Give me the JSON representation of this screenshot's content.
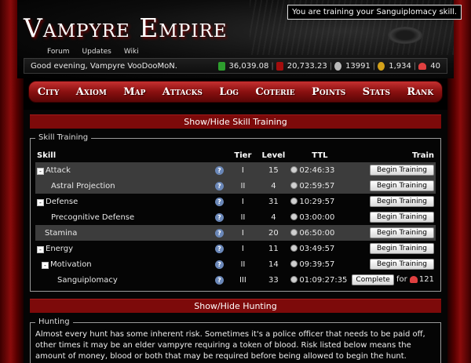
{
  "notice": "You are training your Sanguiplomacy skill.",
  "logo": "Vampyre Empire",
  "top_links": [
    "Forum",
    "Updates",
    "Wiki"
  ],
  "status": {
    "greeting": "Good evening, Vampyre VooDooMoN.",
    "money": "36,039.08",
    "blood": "20,733.23",
    "population": "13991",
    "coins": "1,934",
    "hearts": "40"
  },
  "menu": [
    "City",
    "Axiom",
    "Map",
    "Attacks",
    "Log",
    "Coterie",
    "Points",
    "Stats",
    "Rank"
  ],
  "skill_toggle": "Show/Hide Skill Training",
  "skill_legend": "Skill Training",
  "skill_headers": {
    "skill": "Skill",
    "tier": "Tier",
    "level": "Level",
    "ttl": "TTL",
    "train": "Train"
  },
  "skills": [
    {
      "box": "-",
      "name": "Attack",
      "tier": "I",
      "level": "15",
      "ttl": "02:46:33",
      "action": "Begin Training"
    },
    {
      "box": "",
      "name": "Astral Projection",
      "tier": "II",
      "level": "4",
      "ttl": "02:59:57",
      "action": "Begin Training"
    },
    {
      "box": "-",
      "name": "Defense",
      "tier": "I",
      "level": "31",
      "ttl": "10:29:57",
      "action": "Begin Training"
    },
    {
      "box": "",
      "name": "Precognitive Defense",
      "tier": "II",
      "level": "4",
      "ttl": "03:00:00",
      "action": "Begin Training"
    },
    {
      "box": "",
      "name": "Stamina",
      "tier": "I",
      "level": "20",
      "ttl": "06:50:00",
      "action": "Begin Training"
    },
    {
      "box": "-",
      "name": "Energy",
      "tier": "I",
      "level": "11",
      "ttl": "03:49:57",
      "action": "Begin Training"
    },
    {
      "box": "-",
      "name": "Motivation",
      "tier": "II",
      "level": "14",
      "ttl": "09:39:57",
      "action": "Begin Training"
    },
    {
      "box": "",
      "name": "Sanguiplomacy",
      "tier": "III",
      "level": "33",
      "ttl": "01:09:27:35",
      "action": "Complete",
      "for_label": "for",
      "cost": "121"
    }
  ],
  "hunt_toggle": "Show/Hide Hunting",
  "hunt_legend": "Hunting",
  "hunt_text": "Almost every hunt has some inherent risk. Sometimes it's a police officer that needs to be paid off, other times it may be an elder vampyre requiring a token of blood. Risk listed below means the amount of money, blood or both that may be required before being allowed to begin the hunt."
}
